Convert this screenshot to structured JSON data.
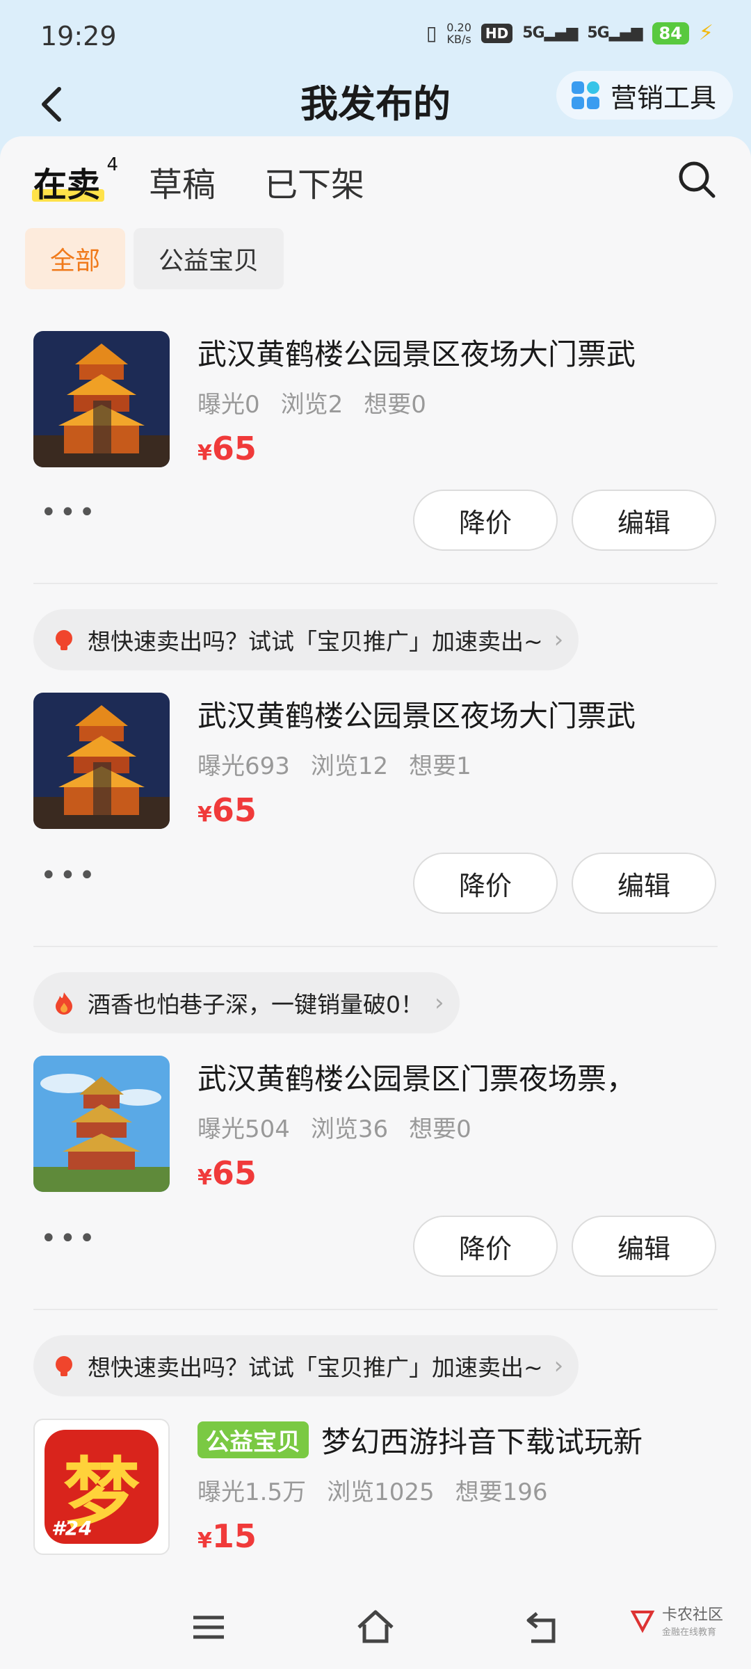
{
  "status_bar": {
    "time": "19:29",
    "net_speed_value": "0.20",
    "net_speed_unit": "KB/s",
    "hd_label": "HD",
    "signal1": "5G",
    "signal2": "5G",
    "battery": "84"
  },
  "header": {
    "title": "我发布的",
    "marketing_label": "营销工具"
  },
  "tabs": [
    {
      "label": "在卖",
      "count": "4"
    },
    {
      "label": "草稿"
    },
    {
      "label": "已下架"
    }
  ],
  "filters": [
    "全部",
    "公益宝贝"
  ],
  "items": [
    {
      "title": "武汉黄鹤楼公园景区夜场大门票武",
      "stats": [
        "曝光0",
        "浏览2",
        "想要0"
      ],
      "currency": "¥",
      "price": "65",
      "actions": [
        "降价",
        "编辑"
      ]
    },
    {
      "promo": "想快速卖出吗？试试「宝贝推广」加速卖出~",
      "title": "武汉黄鹤楼公园景区夜场大门票武",
      "stats": [
        "曝光693",
        "浏览12",
        "想要1"
      ],
      "currency": "¥",
      "price": "65",
      "actions": [
        "降价",
        "编辑"
      ]
    },
    {
      "promo": "酒香也怕巷子深，一键销量破0！",
      "title": "武汉黄鹤楼公园景区门票夜场票，",
      "stats": [
        "曝光504",
        "浏览36",
        "想要0"
      ],
      "currency": "¥",
      "price": "65",
      "actions": [
        "降价",
        "编辑"
      ]
    },
    {
      "promo": "想快速卖出吗？试试「宝贝推广」加速卖出~",
      "badge": "公益宝贝",
      "title": "梦幻西游抖音下载试玩新",
      "stats": [
        "曝光1.5万",
        "浏览1025",
        "想要196"
      ],
      "currency": "¥",
      "price": "15",
      "thumb_text": "梦",
      "thumb_sub": "#24"
    }
  ],
  "more_label": "•••",
  "watermark": {
    "line1": "卡农社区",
    "line2": "金融在线教育"
  },
  "colors": {
    "accent_price": "#f03a3a",
    "filter_active": "#f07a1b",
    "badge_green": "#7ac943",
    "tab_highlight": "#ffe24a"
  }
}
